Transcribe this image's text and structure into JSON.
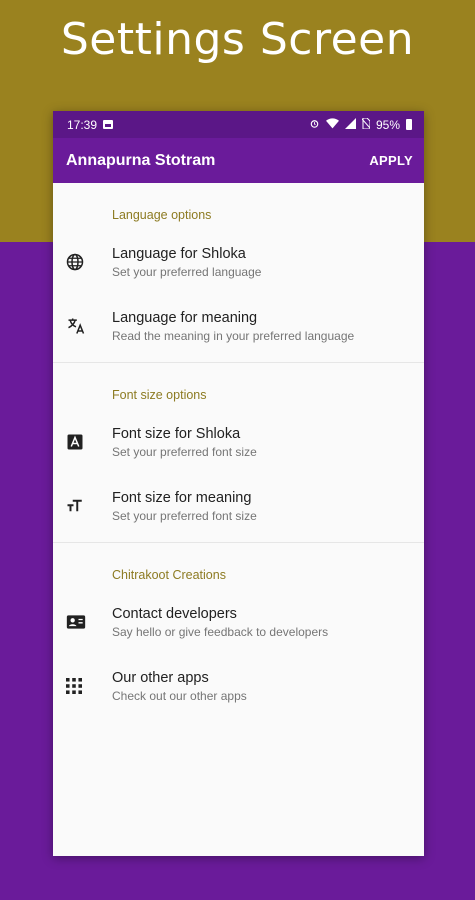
{
  "headline": "Settings Screen",
  "colors": {
    "top_band": "#9a821f",
    "bottom_band": "#6a1b9a",
    "appbar": "#6a1b9a",
    "statusbar": "#5b1787",
    "section_header": "#8d7b22"
  },
  "statusbar": {
    "time": "17:39",
    "battery": "95%",
    "icons": [
      "image-icon",
      "alarm-icon",
      "wifi-icon",
      "signal-icon",
      "no-sim-icon",
      "battery-icon"
    ]
  },
  "appbar": {
    "title": "Annapurna Stotram",
    "action": "APPLY"
  },
  "sections": [
    {
      "header": "Language options",
      "items": [
        {
          "icon": "globe-icon",
          "title": "Language for Shloka",
          "subtitle": "Set your preferred language"
        },
        {
          "icon": "translate-icon",
          "title": "Language for meaning",
          "subtitle": "Read the meaning in your preferred language"
        }
      ]
    },
    {
      "header": "Font size options",
      "items": [
        {
          "icon": "font-box-icon",
          "title": "Font size for Shloka",
          "subtitle": "Set your preferred font size"
        },
        {
          "icon": "text-size-icon",
          "title": "Font size for meaning",
          "subtitle": "Set your preferred font size"
        }
      ]
    },
    {
      "header": "Chitrakoot Creations",
      "items": [
        {
          "icon": "contact-card-icon",
          "title": "Contact developers",
          "subtitle": "Say hello or give feedback to developers"
        },
        {
          "icon": "apps-grid-icon",
          "title": "Our other apps",
          "subtitle": "Check out our other apps"
        }
      ]
    }
  ]
}
